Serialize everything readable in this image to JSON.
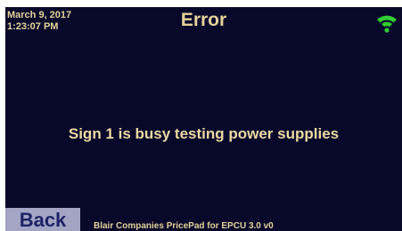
{
  "header": {
    "date": "March 9, 2017",
    "time": "1:23:07 PM",
    "title": "Error",
    "wifi_icon": "wifi-icon",
    "wifi_color": "#33cc33"
  },
  "main": {
    "message": "Sign 1 is busy testing power supplies"
  },
  "footer": {
    "back_label": "Back",
    "app_name": "Blair Companies PricePad for EPCU 3.0 v0"
  },
  "colors": {
    "background": "#08082a",
    "text": "#e6d29a",
    "button_bg": "#a4a4c4",
    "button_text": "#1c2466"
  }
}
